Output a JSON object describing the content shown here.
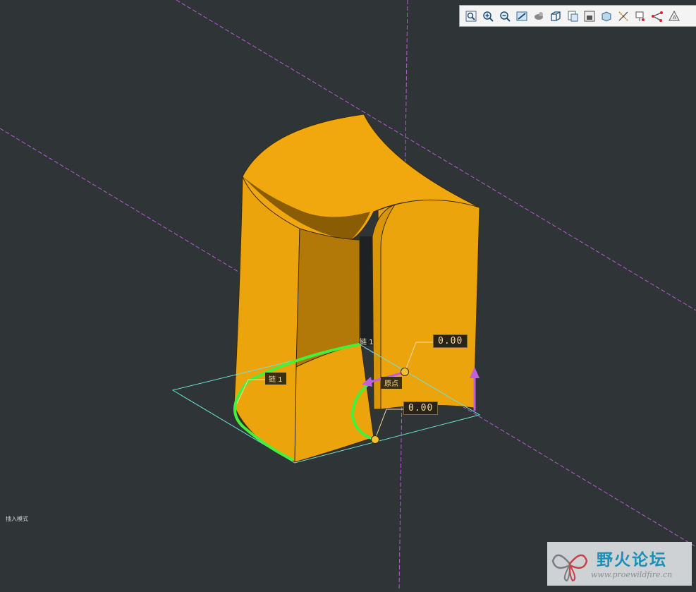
{
  "toolbar": {
    "icons": [
      "refit-icon",
      "zoom-in-icon",
      "zoom-out-icon",
      "repaint-icon",
      "shading-icon",
      "view-orientation-icon",
      "saved-views-icon",
      "layer-icon",
      "view-manager-icon",
      "datum-axis-icon",
      "datum-point-icon",
      "csys-icon",
      "annotation-icon"
    ]
  },
  "annotations": {
    "chain_label": "链 1",
    "chain_label_top": "链 1",
    "origin_label": "原点",
    "dim_top": "0.00",
    "dim_bottom": "0.00"
  },
  "status": {
    "mode_text": "插入模式"
  },
  "watermark": {
    "title": "野火论坛",
    "url": "www.proewildfire.cn"
  },
  "colors": {
    "background": "#2f3436",
    "surface": "#eca40c",
    "chain": "#44f03a",
    "datum": "#b85bd2",
    "sketch_plane": "#6fe0d0"
  }
}
